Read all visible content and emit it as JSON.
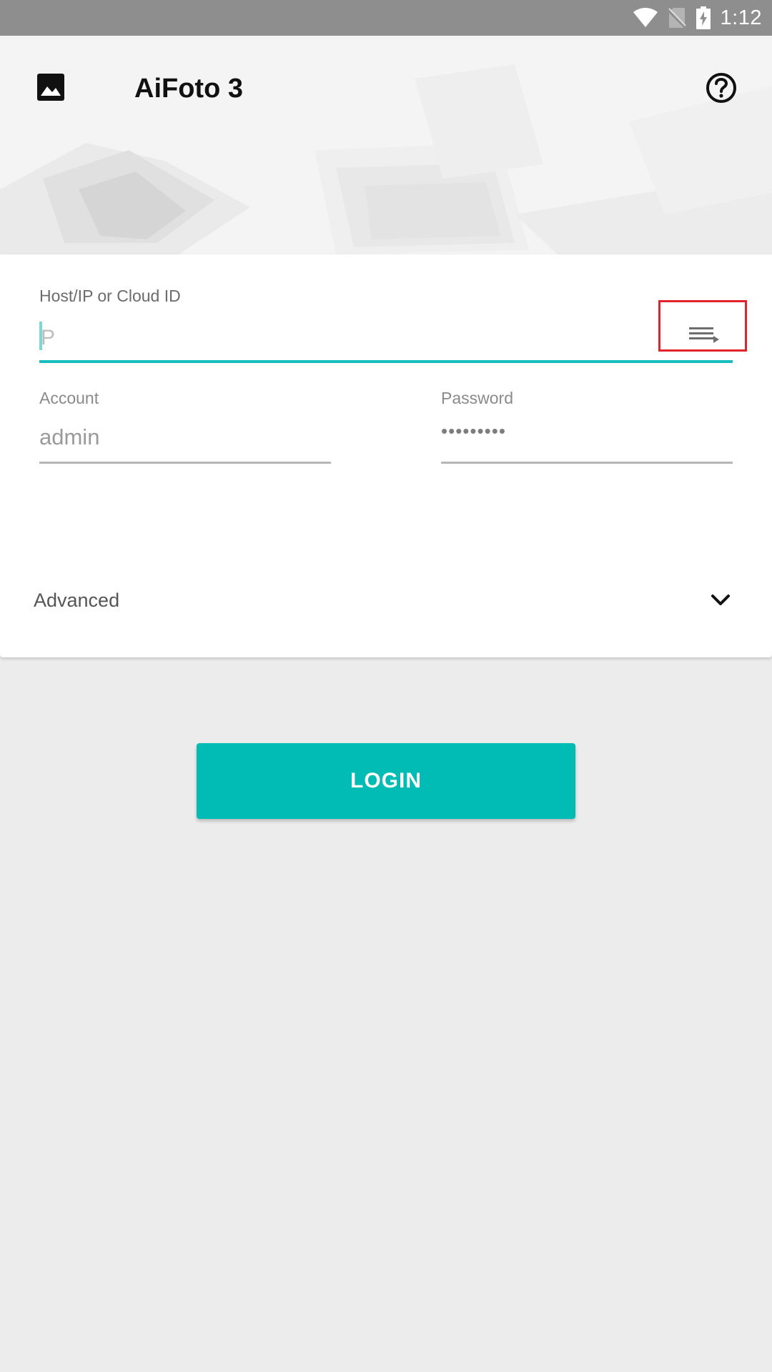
{
  "status_bar": {
    "time": "1:12",
    "icons": [
      "wifi-icon",
      "no-sim-icon",
      "battery-charging-icon"
    ]
  },
  "header": {
    "app_icon": "image-icon",
    "title": "AiFoto 3",
    "help_icon": "help-circle-icon"
  },
  "login_form": {
    "host": {
      "label": "Host/IP or Cloud ID",
      "placeholder": "P",
      "value": "",
      "history_icon": "history-list-icon"
    },
    "account": {
      "label": "Account",
      "value": "admin"
    },
    "password": {
      "label": "Password",
      "masked_value": "•••••••••"
    },
    "advanced": {
      "label": "Advanced",
      "icon": "chevron-down-icon"
    }
  },
  "login_button": {
    "label": "LOGIN"
  },
  "colors": {
    "accent": "#00bcb5",
    "status_bar": "#8e8e8e",
    "page_background": "#ececed",
    "highlight_box": "#e3222b"
  }
}
